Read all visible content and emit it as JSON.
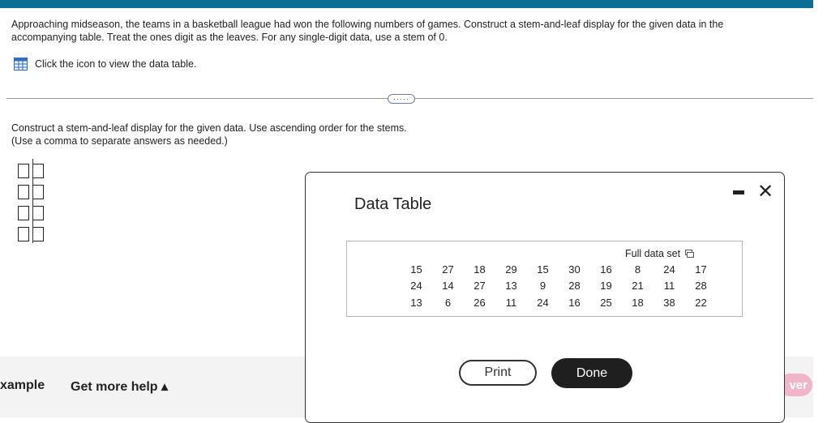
{
  "question": {
    "text": "Approaching midseason, the teams in a basketball league had won the following numbers of games. Construct a stem-and-leaf display for the given data in the accompanying table. Treat the ones digit as the leaves. For any single-digit data, use a stem of 0.",
    "icon_link": "Click the icon to view the data table."
  },
  "expand_label": "·····",
  "instructions": {
    "line1": "Construct a stem-and-leaf display for the given data. Use ascending order for the stems.",
    "line2": "(Use a comma to separate answers as needed.)"
  },
  "footer": {
    "example": "xample",
    "more_help": "Get more help ▴",
    "answer": "ver"
  },
  "modal": {
    "title": "Data Table",
    "full_data_set": "Full data set",
    "rows": [
      [
        "15",
        "27",
        "18",
        "29",
        "15",
        "30",
        "16",
        "8",
        "24",
        "17"
      ],
      [
        "24",
        "14",
        "27",
        "13",
        "9",
        "28",
        "19",
        "21",
        "11",
        "28"
      ],
      [
        "13",
        "6",
        "26",
        "11",
        "24",
        "16",
        "25",
        "18",
        "38",
        "22"
      ]
    ],
    "print_label": "Print",
    "done_label": "Done"
  },
  "colors": {
    "topbar": "#0a6e95",
    "done_button": "#1f1f1f",
    "answer_pill": "#f0b5c8"
  }
}
